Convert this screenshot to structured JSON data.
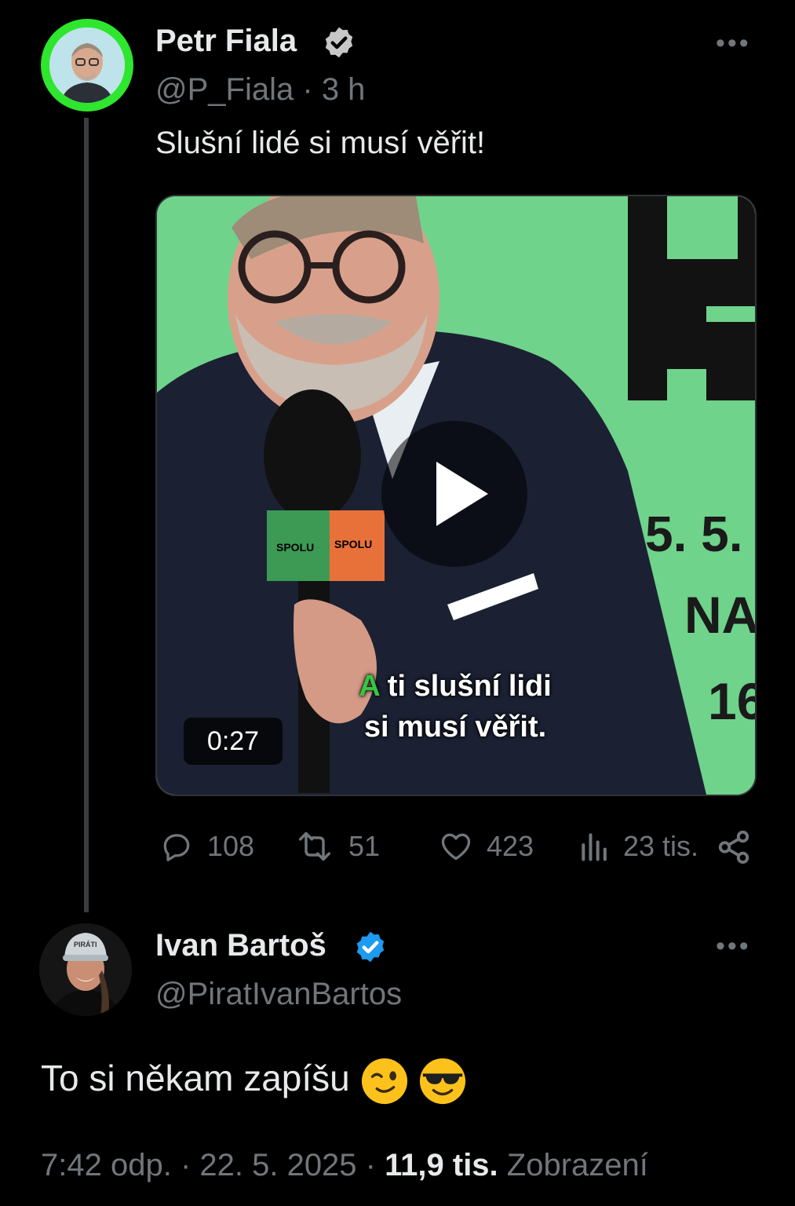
{
  "original_tweet": {
    "author_name": "Petr Fiala",
    "verified": true,
    "handle": "@P_Fiala",
    "separator": "·",
    "time_ago": "3 h",
    "more_label": "•••",
    "text": "Slušní lidé si musí věřit!",
    "video": {
      "duration": "0:27",
      "caption_first_word": "A",
      "caption_line1_rest": " ti slušní lidi",
      "caption_line2": "si musí věřit.",
      "mic_labels": [
        "SPOLU",
        "SPOLU"
      ],
      "background_letters": [
        "F",
        "5. 5.",
        "NA",
        "16"
      ]
    },
    "stats": {
      "replies": "108",
      "reposts": "51",
      "likes": "423",
      "views": "23 tis."
    }
  },
  "reply_tweet": {
    "author_name": "Ivan Bartoš",
    "verified": true,
    "handle": "@PiratIvanBartos",
    "more_label": "•••",
    "text": "To si někam zapíšu",
    "emojis": [
      "winking-face",
      "smiling-face-with-sunglasses"
    ],
    "cap_label": "PIRÁTI",
    "meta": {
      "time": "7:42 odp.",
      "sep1": " · ",
      "date": "22. 5. 2025",
      "sep2": " · ",
      "views_count": "11,9 tis.",
      "views_label": " Zobrazení"
    }
  },
  "colors": {
    "background": "#000000",
    "text_primary": "#e7e9ea",
    "text_secondary": "#71767b",
    "verified_blue": "#1d9bf0",
    "avatar_ring": "#2ee62e",
    "video_green": "#6fd38b",
    "caption_accent": "#35c742"
  }
}
